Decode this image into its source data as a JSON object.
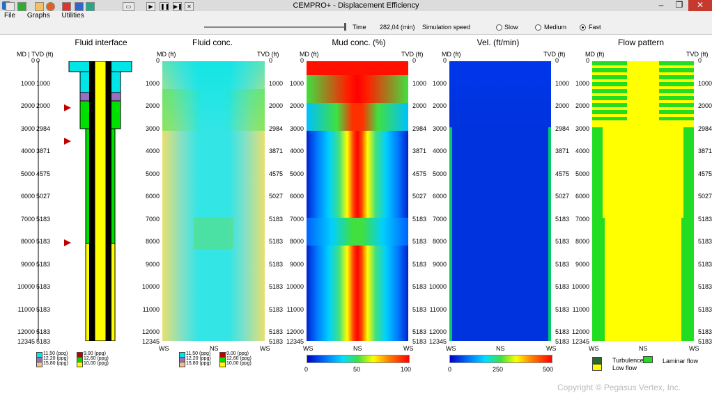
{
  "window": {
    "title": "CEMPRO+ - Displacement Efficiency"
  },
  "menu": [
    "File",
    "Graphs",
    "Utilities"
  ],
  "toolbar": {
    "time_label": "Time",
    "time_value": "282,04 (min)",
    "speed_label": "Simulation speed",
    "speeds": [
      "Slow",
      "Medium",
      "Fast"
    ],
    "selected_speed": "Fast",
    "progress": 1.0
  },
  "depth_labels_md": [
    "0",
    "1000",
    "2000",
    "3000",
    "4000",
    "5000",
    "6000",
    "7000",
    "8000",
    "9000",
    "10000",
    "11000",
    "12000",
    "12345"
  ],
  "depth_labels_tvd": [
    "0",
    "1000",
    "2000",
    "2984",
    "3871",
    "4575",
    "5027",
    "5183",
    "5183",
    "5183",
    "5183",
    "5183",
    "5183",
    "5183"
  ],
  "panels": {
    "fluid_interface": {
      "title": "Fluid interface",
      "axis": "MD | TVD (ft)"
    },
    "fluid_conc": {
      "title": "Fluid conc.",
      "md": "MD (ft)",
      "tvd": "TVD (ft)"
    },
    "mud_conc": {
      "title": "Mud conc. (%)",
      "md": "MD (ft)",
      "tvd": "TVD (ft)"
    },
    "velocity": {
      "title": "Vel. (ft/min)",
      "md": "MD (ft)",
      "tvd": "TVD (ft)"
    },
    "flow_pattern": {
      "title": "Flow pattern",
      "md": "MD (ft)",
      "tvd": "TVD (ft)"
    }
  },
  "bottom_labels": {
    "left": "WS",
    "mid": "NS",
    "right": "WS"
  },
  "fluid_legend": [
    {
      "label": "11,50 (ppg)",
      "color": "#00e5e5"
    },
    {
      "label": "9,00 (ppg)",
      "color": "#c00000"
    },
    {
      "label": "12,20 (ppg)",
      "color": "#9b6fc0"
    },
    {
      "label": "12,60 (ppg)",
      "color": "#00e000"
    },
    {
      "label": "15,80 (ppg)",
      "color": "#f0c090"
    },
    {
      "label": "10,00 (ppg)",
      "color": "#ffff00"
    }
  ],
  "mud_scale": [
    "0",
    "50",
    "100"
  ],
  "vel_scale": [
    "0",
    "250",
    "500"
  ],
  "flow_legend": {
    "turbulence": "Turbulence",
    "laminar": "Laminar flow",
    "low": "Low flow"
  },
  "colors": {
    "turbulence": "#2a6a2a",
    "laminar": "#22dd22",
    "low": "#ffff00"
  },
  "footer": "Copyright © Pegasus Vertex, Inc."
}
